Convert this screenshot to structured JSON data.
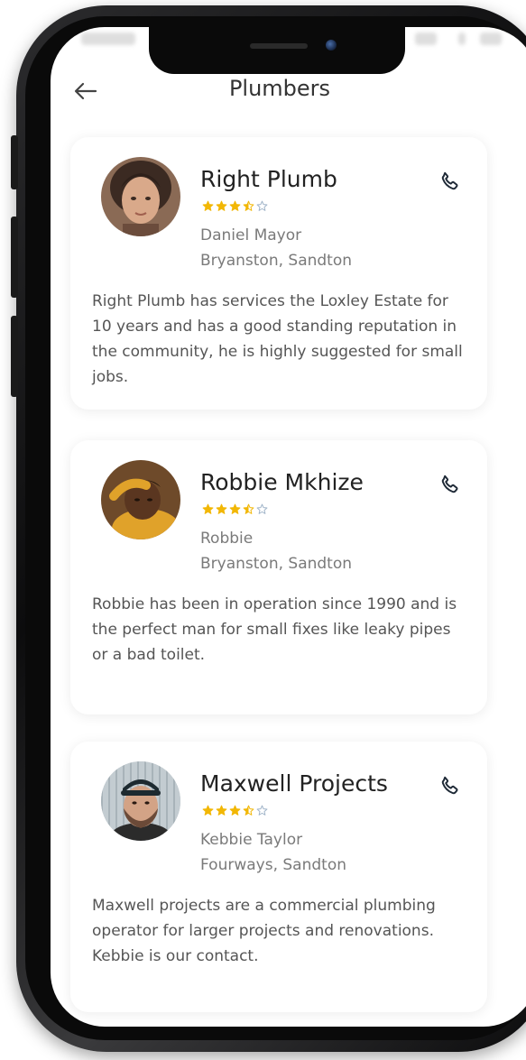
{
  "header": {
    "title": "Plumbers",
    "back_icon": "arrow-left-icon"
  },
  "rating_colors": {
    "filled": "#F2B705",
    "empty": "#9FB3C8"
  },
  "plumbers": [
    {
      "name": "Right Plumb",
      "rating": 3.5,
      "max_rating": 5,
      "contact_person": "Daniel Mayor",
      "location": "Bryanston, Sandton",
      "description": "Right Plumb has services the Loxley Estate for 10 years and has a good standing reputation in the community, he is highly suggested for small jobs.",
      "call_icon": "phone-icon"
    },
    {
      "name": "Robbie Mkhize",
      "rating": 3.5,
      "max_rating": 5,
      "contact_person": "Robbie",
      "location": "Bryanston, Sandton",
      "description": "Robbie has been in operation since 1990 and is the perfect man for small fixes like leaky pipes or a bad toilet.",
      "call_icon": "phone-icon"
    },
    {
      "name": "Maxwell Projects",
      "rating": 3.5,
      "max_rating": 5,
      "contact_person": "Kebbie Taylor",
      "location": "Fourways, Sandton",
      "description": "Maxwell projects are a commercial plumbing operator for larger projects and renovations. Kebbie is our contact.",
      "call_icon": "phone-icon"
    }
  ]
}
